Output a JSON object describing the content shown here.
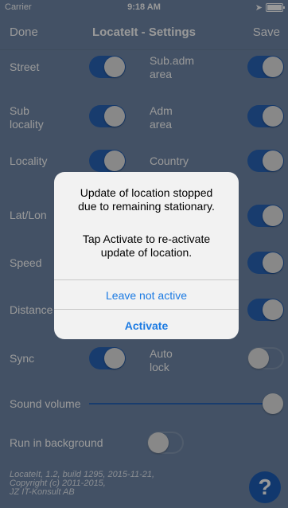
{
  "statusbar": {
    "carrier": "Carrier",
    "time": "9:18 AM"
  },
  "navbar": {
    "left": "Done",
    "title": "LocateIt - Settings",
    "right": "Save"
  },
  "rows": {
    "street": "Street",
    "sub_locality": "Sub\nlocality",
    "locality": "Locality",
    "latlon": "Lat/Lon",
    "speed": "Speed",
    "distance": "Distance",
    "sync": "Sync",
    "sub_adm_area": "Sub.adm\narea",
    "adm_area": "Adm\narea",
    "country": "Country",
    "auto_lock": "Auto\nlock"
  },
  "sound_volume_label": "Sound volume",
  "run_in_background_label": "Run in background",
  "toggles": {
    "street": true,
    "sub_locality": true,
    "locality": true,
    "sync": true,
    "sub_adm_area": true,
    "adm_area": true,
    "country": true,
    "right_row4": true,
    "right_row5": true,
    "right_row6": true,
    "auto_lock": false,
    "run_in_background": false
  },
  "sound_volume_value": 1.0,
  "footer": {
    "line1": "LocateIt, 1.2, build 1295, 2015-11-21,",
    "line2": "Copyright (c) 2011-2015,",
    "line3": "JZ IT-Konsult AB"
  },
  "help_icon_glyph": "?",
  "alert": {
    "message1": "Update of location stopped\ndue to remaining stationary.",
    "message2": "Tap Activate to re-activate\nupdate of location.",
    "leave_button": "Leave not active",
    "activate_button": "Activate"
  },
  "colors": {
    "background": "#7088a9",
    "accent": "#2864b8",
    "alert_button": "#1c7be3"
  }
}
